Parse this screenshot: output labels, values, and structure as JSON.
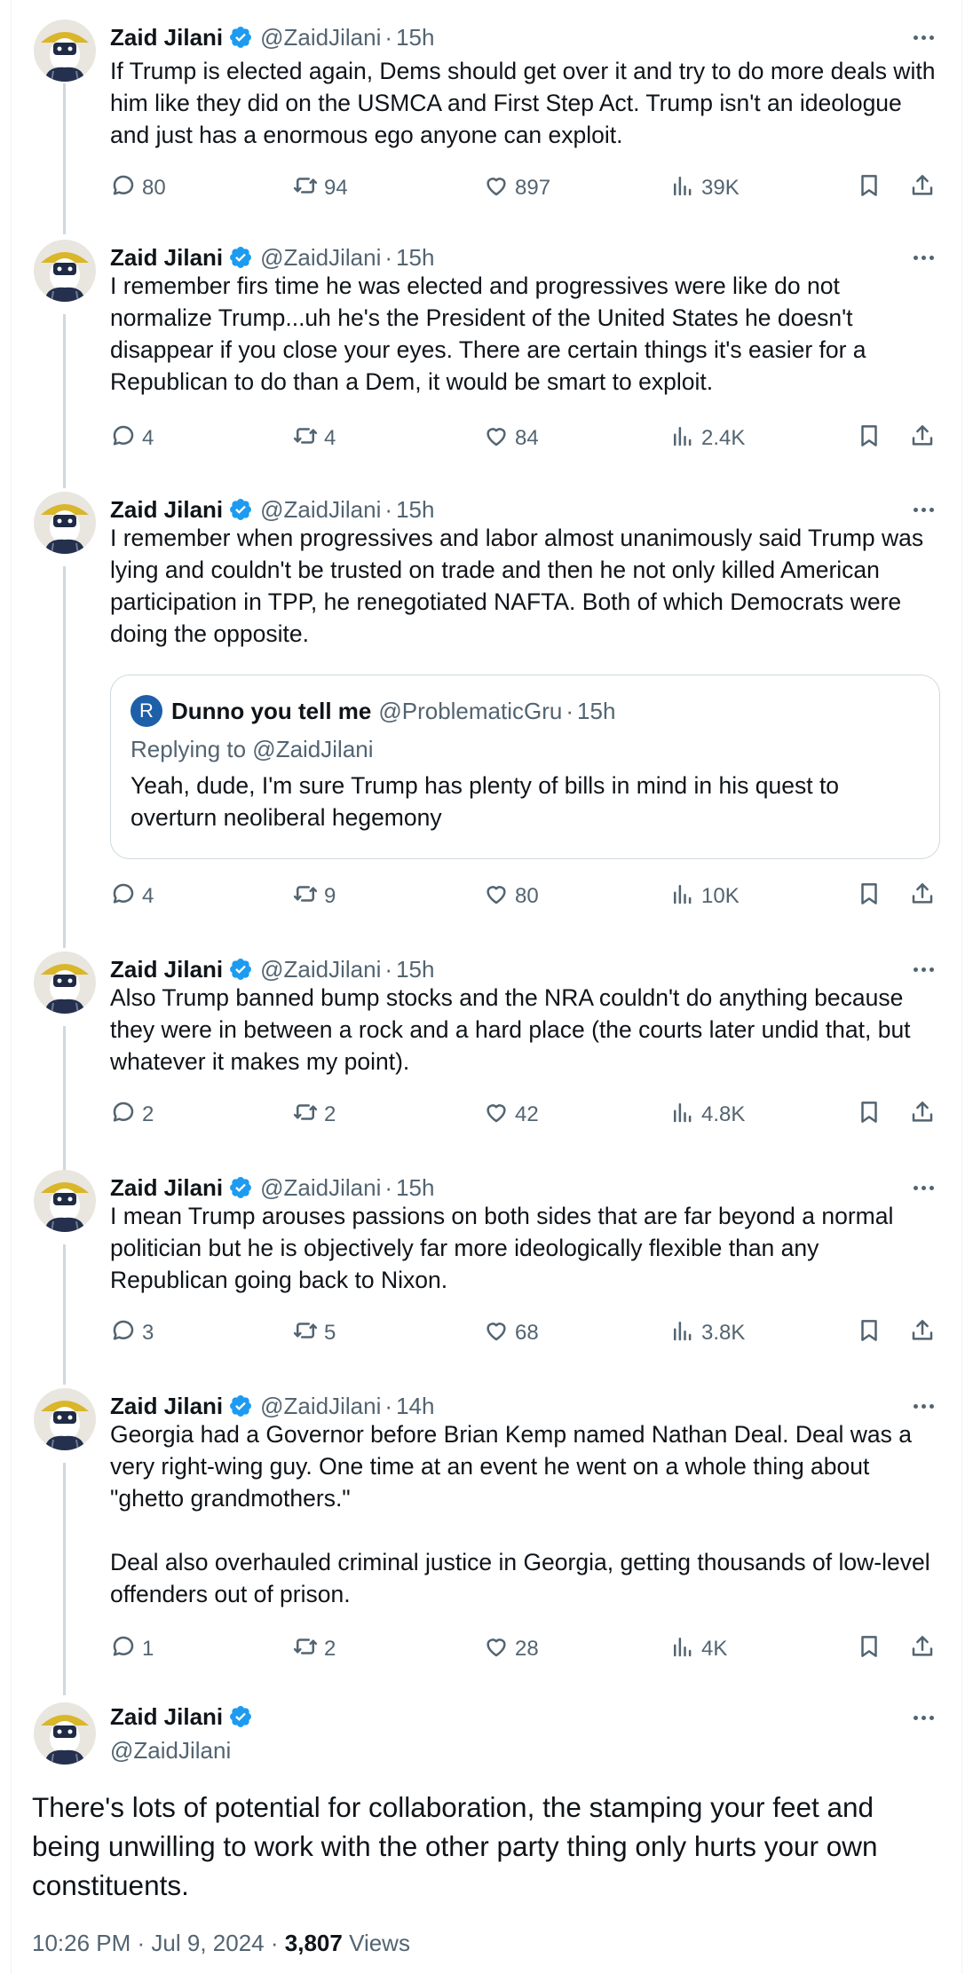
{
  "author": {
    "name": "Zaid Jilani",
    "handle": "@ZaidJilani"
  },
  "colors": {
    "verified": "#1d9bf0",
    "text": "#0f1419",
    "muted": "#536471",
    "line": "#cfd9de"
  },
  "tweets": [
    {
      "time": "15h",
      "text": "If Trump is elected again, Dems should get over it and try to do more deals with him like they did on the USMCA and First Step Act. Trump isn't an ideologue and just has a enormous ego anyone can exploit.",
      "replies": "80",
      "reposts": "94",
      "likes": "897",
      "views": "39K"
    },
    {
      "time": "15h",
      "text": "I remember firs time he was elected and progressives were like do not normalize Trump...uh he's the President of the United States he doesn't disappear if you close your eyes. There are certain things it's easier for a Republican to do than a Dem, it would be smart to exploit.",
      "replies": "4",
      "reposts": "4",
      "likes": "84",
      "views": "2.4K"
    },
    {
      "time": "15h",
      "text": "I remember when progressives and labor almost unanimously said Trump was lying and couldn't be trusted on trade and then he not only killed American participation in TPP, he renegotiated NAFTA. Both of which Democrats were doing the opposite.",
      "quote": {
        "avatar_letter": "R",
        "name": "Dunno you tell me",
        "handle": "@ProblematicGru",
        "time": "15h",
        "replying": "Replying to @ZaidJilani",
        "text": "Yeah, dude, I'm sure Trump has plenty of bills in mind in his quest to overturn neoliberal hegemony"
      },
      "replies": "4",
      "reposts": "9",
      "likes": "80",
      "views": "10K"
    },
    {
      "time": "15h",
      "text": "Also Trump banned bump stocks and the NRA couldn't do anything because they were in between a rock and a hard place (the courts later undid that, but whatever it makes my point).",
      "replies": "2",
      "reposts": "2",
      "likes": "42",
      "views": "4.8K"
    },
    {
      "time": "15h",
      "text": "I mean Trump arouses passions on both sides that are far beyond a normal politician but he is objectively far more ideologically flexible than any Republican going back to Nixon.",
      "replies": "3",
      "reposts": "5",
      "likes": "68",
      "views": "3.8K"
    },
    {
      "time": "14h",
      "text": "Georgia had a Governor before Brian Kemp named Nathan Deal. Deal was a very right-wing guy. One time at an event he went on a whole thing about \"ghetto grandmothers.\"\n\nDeal also overhauled criminal justice in Georgia, getting thousands of low-level offenders out of prison.",
      "replies": "1",
      "reposts": "2",
      "likes": "28",
      "views": "4K"
    }
  ],
  "main_tweet": {
    "text": "There's lots of potential for collaboration, the stamping your feet and being unwilling to work with the other party thing only hurts your own constituents.",
    "time": "10:26 PM",
    "date": "Jul 9, 2024",
    "views_count": "3,807",
    "views_label": "Views"
  }
}
